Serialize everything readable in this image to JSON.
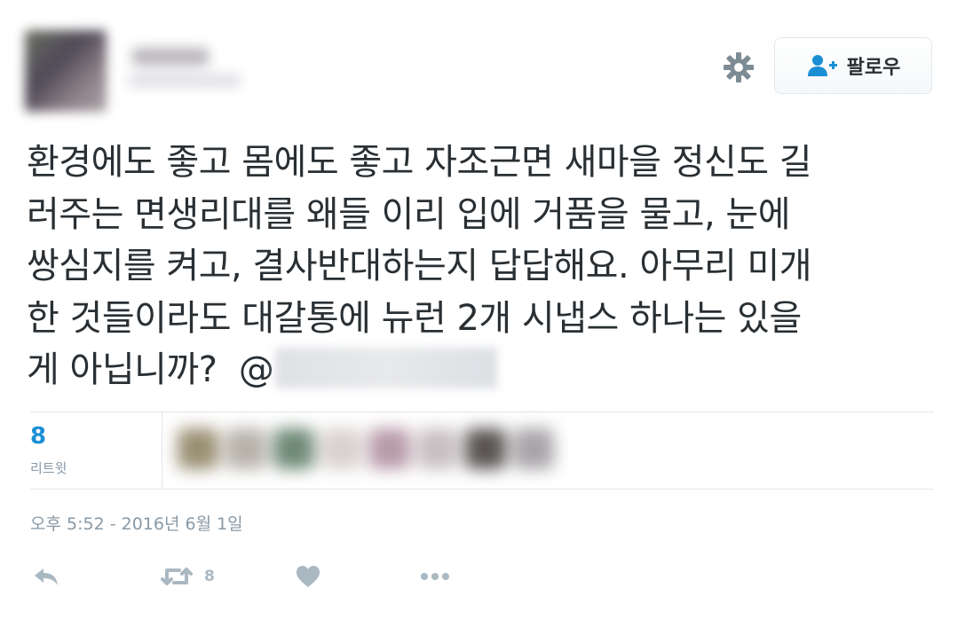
{
  "header": {
    "follow_label": "팔로우",
    "settings_icon": "gear-icon",
    "follow_icon": "user-plus-icon"
  },
  "tweet": {
    "lines": [
      "환경에도 좋고 몸에도 좋고 자조근면 새마을 정신도 길",
      "러주는 면생리대를 왜들 이리 입에 거품을 물고, 눈에",
      "쌍심지를 켜고, 결사반대하는지 답답해요. 아무리 미개",
      "한 것들이라도 대갈통에 뉴런 2개 시냅스 하나는 있을",
      "게 아닙니까?"
    ],
    "mention_prefix": "@"
  },
  "stats": {
    "retweet_count": "8",
    "retweet_label": "리트윗"
  },
  "timestamp": "오후 5:52 - 2016년 6월 1일",
  "actions": {
    "reply_icon": "reply-icon",
    "retweet_icon": "retweet-icon",
    "retweet_count": "8",
    "like_icon": "heart-icon",
    "more_icon": "more-icon"
  },
  "colors": {
    "text": "#292f33",
    "muted": "#8899a6",
    "accent": "#1b8fd4",
    "action_icons": "#aab8c2",
    "border": "#e1e8ed"
  }
}
